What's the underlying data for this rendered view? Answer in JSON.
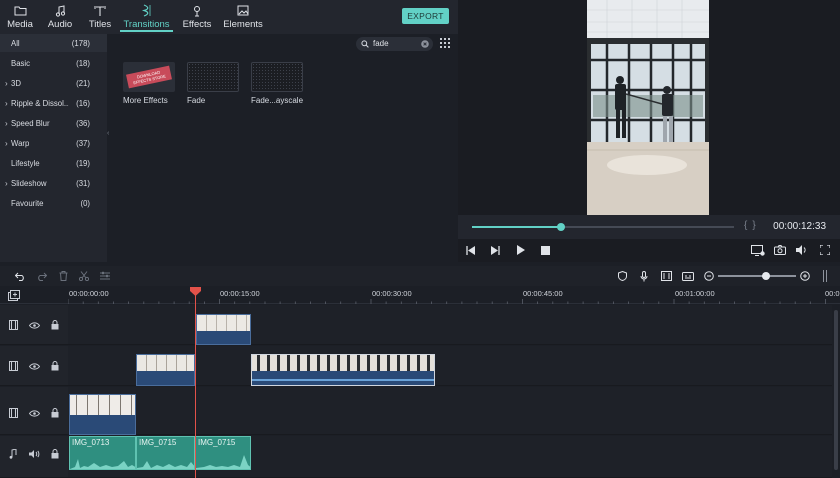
{
  "tabs": [
    {
      "label": "Media",
      "icon": "folder-icon"
    },
    {
      "label": "Audio",
      "icon": "music-note-icon"
    },
    {
      "label": "Titles",
      "icon": "text-icon"
    },
    {
      "label": "Transitions",
      "icon": "transitions-icon",
      "active": true
    },
    {
      "label": "Effects",
      "icon": "effects-icon"
    },
    {
      "label": "Elements",
      "icon": "image-icon"
    }
  ],
  "export_label": "EXPORT",
  "categories": [
    {
      "name": "All",
      "count": "(178)",
      "expandable": false
    },
    {
      "name": "Basic",
      "count": "(18)",
      "expandable": false
    },
    {
      "name": "3D",
      "count": "(21)",
      "expandable": true
    },
    {
      "name": "Ripple & Dissol...",
      "count": "(16)",
      "expandable": true
    },
    {
      "name": "Speed Blur",
      "count": "(36)",
      "expandable": true
    },
    {
      "name": "Warp",
      "count": "(37)",
      "expandable": true
    },
    {
      "name": "Lifestyle",
      "count": "(19)",
      "expandable": false
    },
    {
      "name": "Slideshow",
      "count": "(31)",
      "expandable": true
    },
    {
      "name": "Favourite",
      "count": "(0)",
      "expandable": false
    }
  ],
  "search": {
    "value": "fade"
  },
  "library_items": [
    {
      "label": "More Effects",
      "badge_top": "DOWNLOAD",
      "badge_bottom": "EFFECTS STORE"
    },
    {
      "label": "Fade"
    },
    {
      "label": "Fade...ayscale"
    }
  ],
  "preview": {
    "timecode": "00:00:12:33",
    "progress": 0.34
  },
  "ruler_labels": [
    "00:00:00:00",
    "00:00:15:00",
    "00:00:30:00",
    "00:00:45:00",
    "00:01:00:00",
    "00:0"
  ],
  "audio_clips": [
    "IMG_0713",
    "IMG_0715",
    "IMG_0715"
  ],
  "zoom_level": 0.62,
  "colors": {
    "accent": "#62d1c6",
    "playhead": "#e3524a",
    "video_clip": "#2a4a77",
    "audio_clip": "#2f8f80"
  }
}
